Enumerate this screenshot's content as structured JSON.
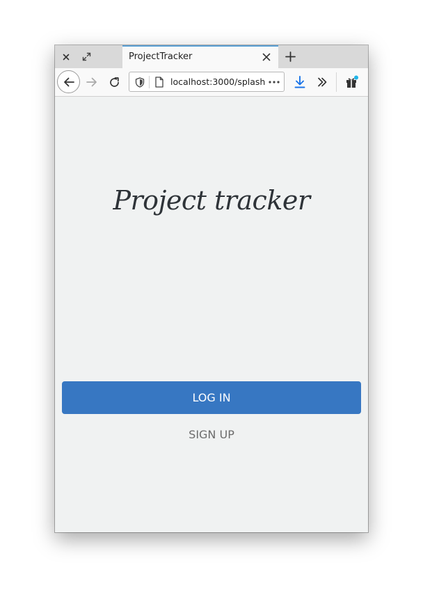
{
  "browser": {
    "tab_title": "ProjectTracker",
    "url": "localhost:3000/splash",
    "icons": {
      "close_window": "close-icon",
      "fullscreen": "expand-icon",
      "tab_close": "close-icon",
      "new_tab": "plus-icon",
      "back": "arrow-left-icon",
      "forward": "arrow-right-icon",
      "reload": "reload-icon",
      "tracking_protection": "shield-icon",
      "page_info": "page-icon",
      "page_actions": "ellipsis-icon",
      "downloads": "download-icon",
      "overflow": "chevrons-right-icon",
      "whats_new": "gift-icon"
    },
    "colors": {
      "tab_accent": "#5a9fd4",
      "download_icon": "#1a73e8",
      "notification_dot": "#1fb4e8"
    }
  },
  "page": {
    "title": "Project tracker",
    "login_label": "LOG IN",
    "signup_label": "SIGN UP",
    "colors": {
      "background": "#f0f2f2",
      "login_button": "#3777c2",
      "title_text": "#2e3338",
      "signup_text": "#6c6c6c"
    }
  }
}
